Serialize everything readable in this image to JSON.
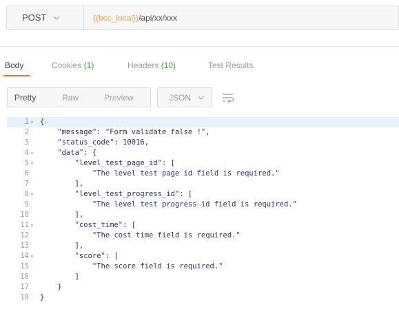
{
  "request": {
    "method": "POST",
    "method_chevron": "chevron-down-icon",
    "url_variable": "{{bcc_local}}",
    "url_path": "/api/xx/xxx"
  },
  "tabs": [
    {
      "label": "Body",
      "count": "",
      "active": true
    },
    {
      "label": "Cookies",
      "count": "(1)",
      "active": false
    },
    {
      "label": "Headers",
      "count": "(10)",
      "active": false
    },
    {
      "label": "Test Results",
      "count": "",
      "active": false
    }
  ],
  "view_modes": [
    "Pretty",
    "Raw",
    "Preview"
  ],
  "format": {
    "selected": "JSON",
    "chevron": "chevron-down-icon"
  },
  "wrap_icon": "wrap-lines-icon",
  "colors": {
    "accent": "#f26b3a",
    "count": "#3f9b3f",
    "variable": "#e8a24a",
    "code": "#1a1aa6"
  },
  "code": {
    "lines": [
      {
        "n": "1",
        "fold": true,
        "text": "{"
      },
      {
        "n": "2",
        "fold": false,
        "text": "    \"message\": \"Form validate false !\","
      },
      {
        "n": "3",
        "fold": false,
        "text": "    \"status_code\": 10016,"
      },
      {
        "n": "4",
        "fold": true,
        "text": "    \"data\": {"
      },
      {
        "n": "5",
        "fold": true,
        "text": "        \"level_test_page_id\": ["
      },
      {
        "n": "6",
        "fold": false,
        "text": "            \"The level test page id field is required.\""
      },
      {
        "n": "7",
        "fold": false,
        "text": "        ],"
      },
      {
        "n": "8",
        "fold": true,
        "text": "        \"level_test_progress_id\": ["
      },
      {
        "n": "9",
        "fold": false,
        "text": "            \"The level test progress id field is required.\""
      },
      {
        "n": "10",
        "fold": false,
        "text": "        ],"
      },
      {
        "n": "11",
        "fold": true,
        "text": "        \"cost_time\": ["
      },
      {
        "n": "12",
        "fold": false,
        "text": "            \"The cost time field is required.\""
      },
      {
        "n": "13",
        "fold": false,
        "text": "        ],"
      },
      {
        "n": "14",
        "fold": true,
        "text": "        \"score\": ["
      },
      {
        "n": "15",
        "fold": false,
        "text": "            \"The score field is required.\""
      },
      {
        "n": "16",
        "fold": false,
        "text": "        ]"
      },
      {
        "n": "17",
        "fold": false,
        "text": "    }"
      },
      {
        "n": "18",
        "fold": false,
        "text": "}"
      }
    ]
  }
}
